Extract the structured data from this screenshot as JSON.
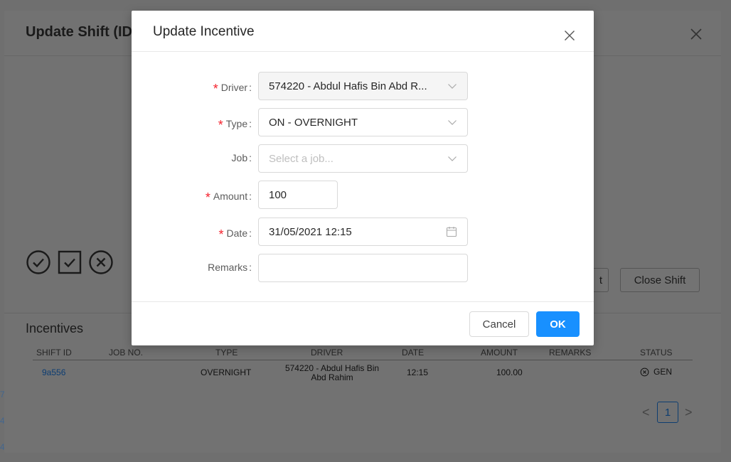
{
  "background": {
    "shift_modal": {
      "title": "Update Shift (ID:",
      "status_buttons": [
        "check-circle-icon",
        "check-square-icon",
        "close-circle-icon"
      ],
      "partial_button_label": "t",
      "close_shift_label": "Close Shift"
    },
    "incentives": {
      "heading": "Incentives",
      "columns": [
        "SHIFT ID",
        "JOB NO.",
        "TYPE",
        "DRIVER",
        "DATE",
        "AMOUNT",
        "REMARKS",
        "STATUS"
      ],
      "rows": [
        {
          "shift_id": "9a556",
          "job_no": "",
          "type": "OVERNIGHT",
          "driver": "574220 - Abdul Hafis Bin Abd Rahim",
          "date": "12:15",
          "amount": "100.00",
          "remarks": "",
          "status": "GEN"
        }
      ]
    },
    "pagination": {
      "prev": "<",
      "current": "1",
      "next": ">"
    }
  },
  "modal": {
    "title": "Update Incentive",
    "close_icon": "close-icon",
    "fields": {
      "driver": {
        "label": "Driver",
        "required": true,
        "value": "574220 - Abdul Hafis Bin Abd R...",
        "disabled": true
      },
      "type": {
        "label": "Type",
        "required": true,
        "value": "ON - OVERNIGHT"
      },
      "job": {
        "label": "Job",
        "required": false,
        "placeholder": "Select a job..."
      },
      "amount": {
        "label": "Amount",
        "required": true,
        "value": "100"
      },
      "date": {
        "label": "Date",
        "required": true,
        "value": "31/05/2021 12:15"
      },
      "remarks": {
        "label": "Remarks",
        "required": false,
        "value": ""
      }
    },
    "footer": {
      "cancel_label": "Cancel",
      "ok_label": "OK"
    }
  },
  "colors": {
    "primary": "#1890ff",
    "required": "#f5222d",
    "overlay": "#6d6d6d"
  }
}
